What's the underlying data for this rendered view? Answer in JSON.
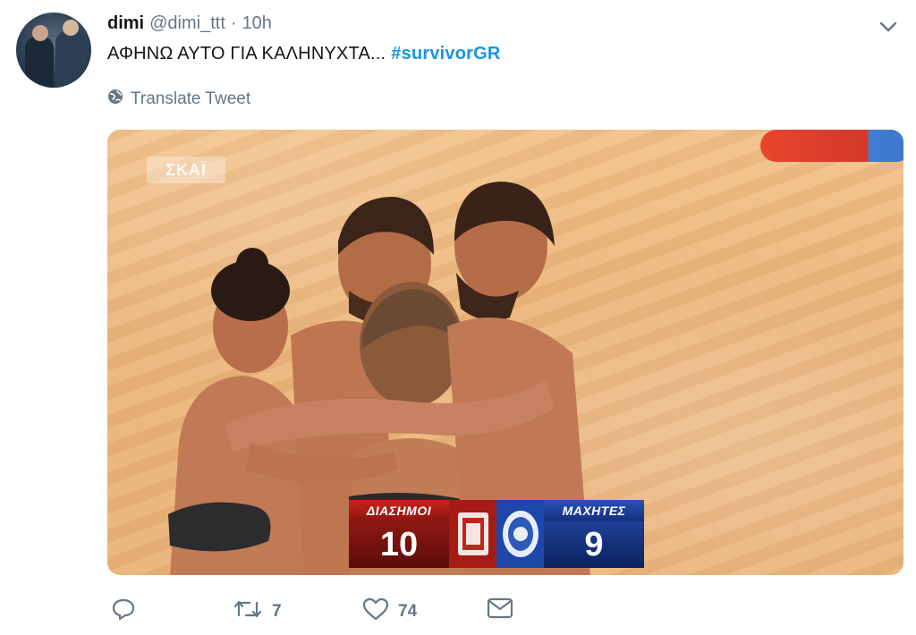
{
  "user": {
    "name": "dimi",
    "handle": "@dimi_ttt",
    "separator": "·",
    "time": "10h"
  },
  "tweet": {
    "text": "ΑΦΗΝΩ ΑΥΤΟ ΓΙΑ ΚΑΛΗΝΥΧΤΑ...",
    "hashtag": "#survivorGR",
    "translate_label": "Translate Tweet"
  },
  "media": {
    "channel_logo": "ΣΚΑΪ",
    "scoreboard": {
      "left_team": "ΔΙΑΣΗΜΟΙ",
      "left_score": "10",
      "right_team": "ΜΑΧΗΤΕΣ",
      "right_score": "9"
    }
  },
  "actions": {
    "reply_icon": "reply-icon",
    "retweet_icon": "retweet-icon",
    "retweet_count": "7",
    "like_icon": "heart-icon",
    "like_count": "74",
    "dm_icon": "envelope-icon"
  },
  "colors": {
    "hashtag": "#1b95e0",
    "secondary_text": "#657786",
    "left_team": "#a51c17",
    "right_team": "#1d47a8"
  }
}
